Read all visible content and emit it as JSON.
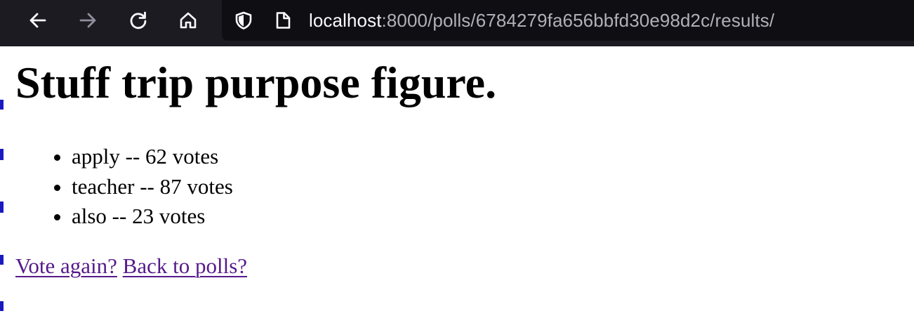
{
  "browser": {
    "url_host": "localhost",
    "url_path": ":8000/polls/6784279fa656bbfd30e98d2c/results/",
    "icons": {
      "back": "arrow-left-icon",
      "forward": "arrow-right-icon",
      "reload": "reload-icon",
      "home": "home-icon",
      "tracking": "shield-icon",
      "page": "page-icon"
    }
  },
  "page": {
    "question": "Stuff trip purpose figure.",
    "results": [
      {
        "text": "apply -- 62 votes"
      },
      {
        "text": "teacher -- 87 votes"
      },
      {
        "text": "also -- 23 votes"
      }
    ],
    "vote_again_link": "Vote again?",
    "back_link": "Back to polls?"
  }
}
